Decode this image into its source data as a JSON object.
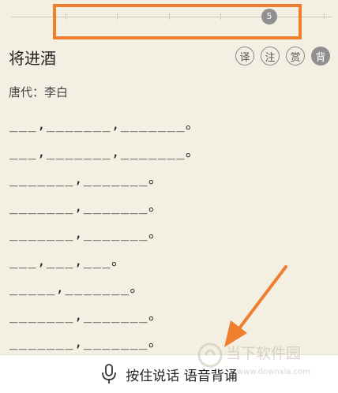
{
  "slider": {
    "thumb_label": "5",
    "position_fraction": 0.82
  },
  "poem": {
    "title": "将进酒",
    "author_line": "唐代：李白",
    "lines": [
      "___,_______,_______。",
      "___,_______,_______。",
      "_______,_______。",
      "_______,_______。",
      "_______,_______。",
      "___,___,___。",
      "_____,_______。",
      "_______,_______。",
      "_______,_______。"
    ]
  },
  "actions": {
    "translate": "译",
    "annotate": "注",
    "appreciate": "赏",
    "recite": "背"
  },
  "bottom_bar": {
    "label": "按住说话 语音背诵"
  },
  "watermark": {
    "text_cn": "当下软件园",
    "text_url": "www.downxia.com"
  },
  "colors": {
    "accent": "#ef7f2f",
    "background": "#f3efe2"
  }
}
